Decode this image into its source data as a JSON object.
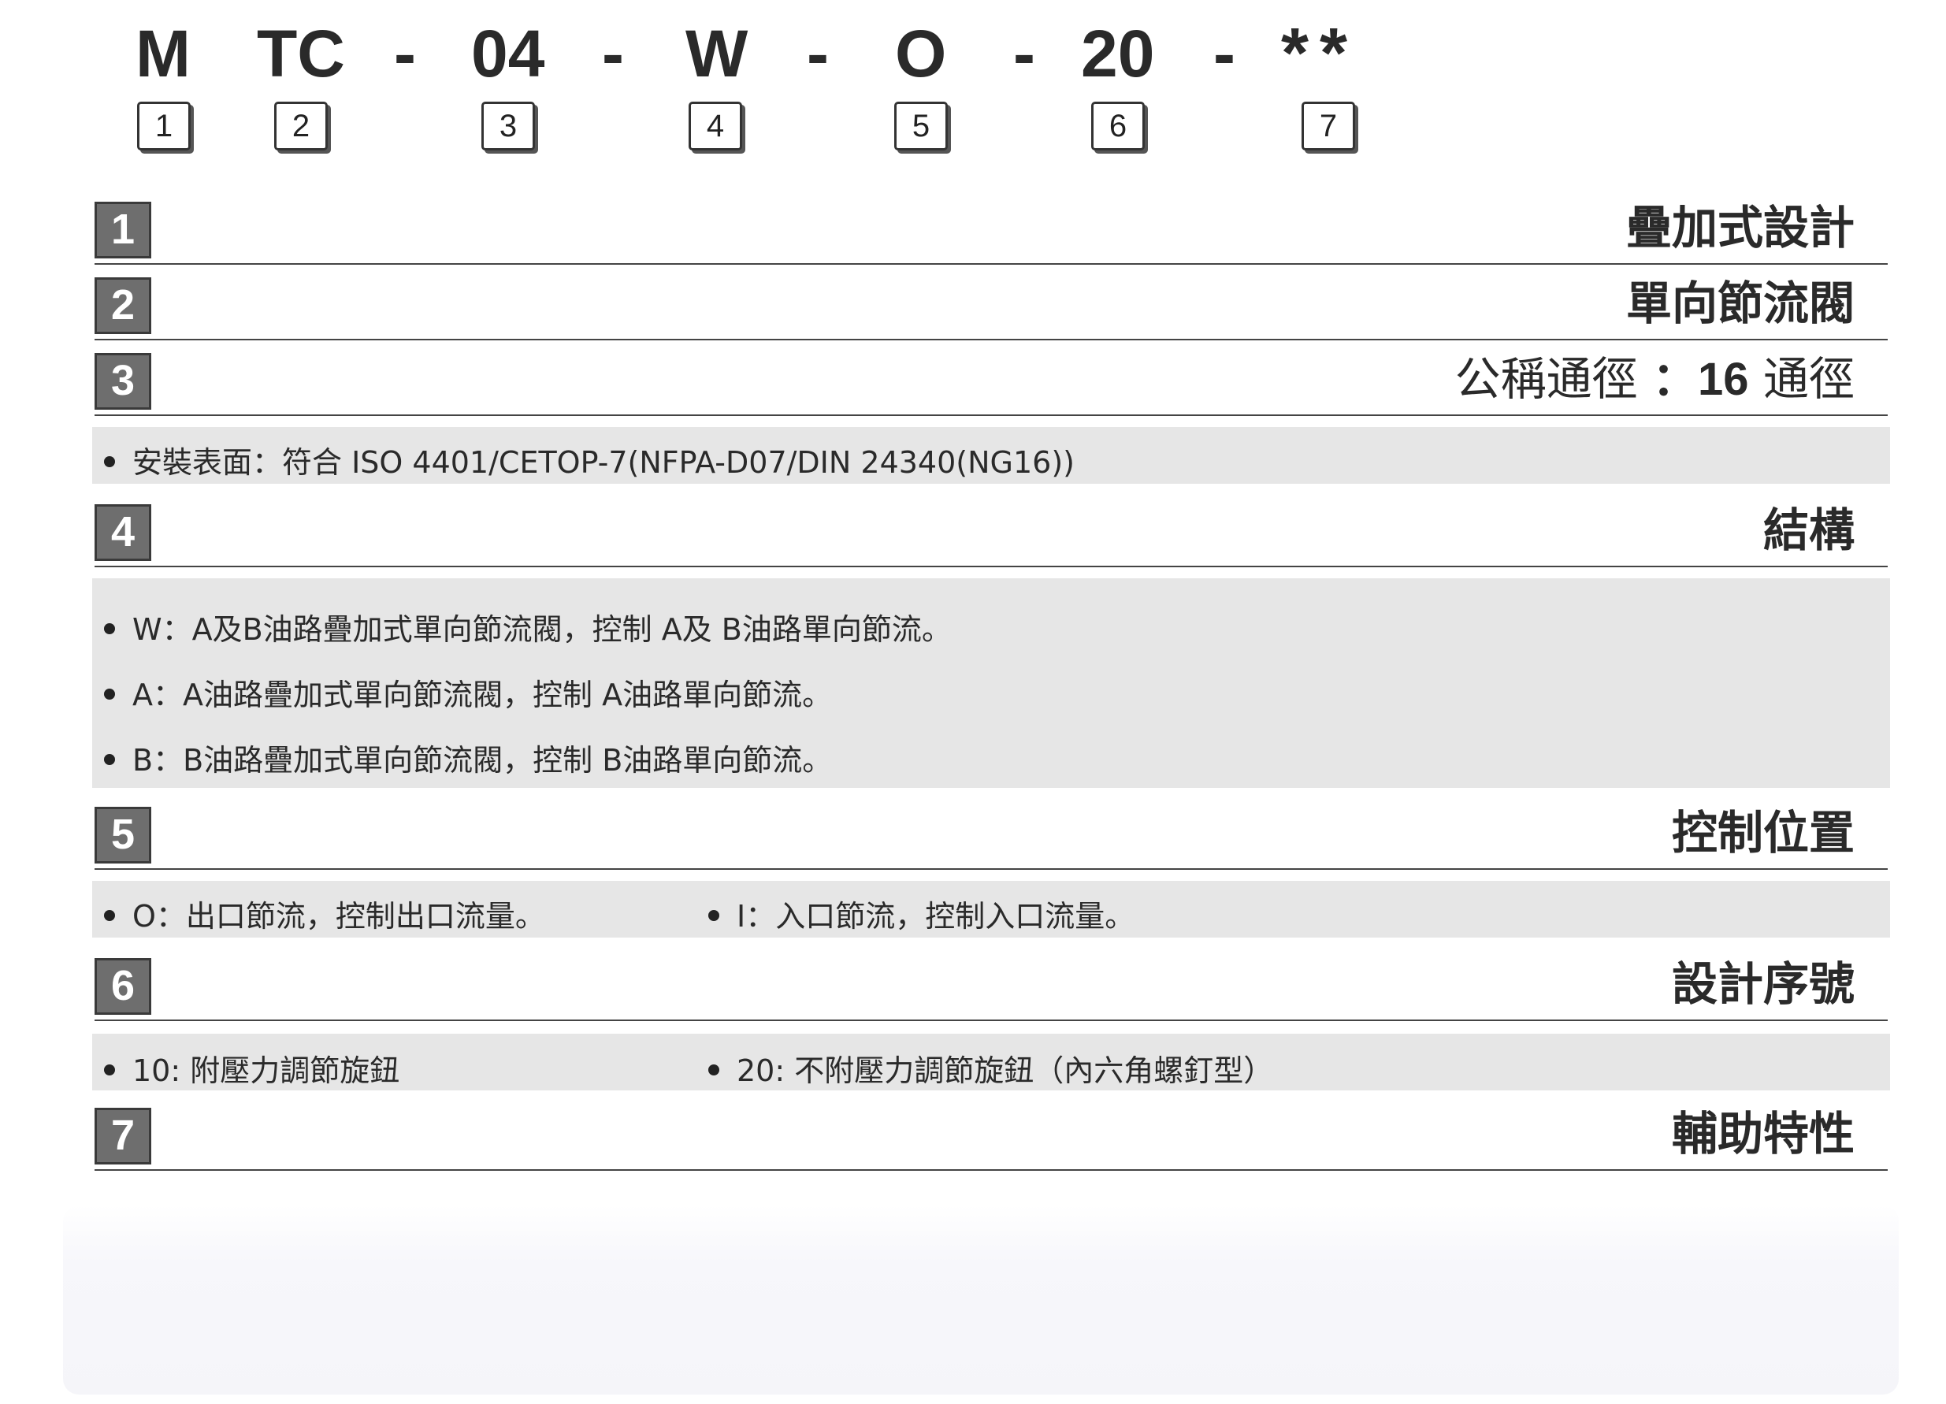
{
  "model_code": {
    "tokens": [
      "M",
      "TC",
      "-",
      "04",
      "-",
      "W",
      "-",
      "O",
      "-",
      "20",
      "-",
      "**"
    ],
    "position_labels": [
      "1",
      "2",
      "3",
      "4",
      "5",
      "6",
      "7"
    ]
  },
  "sections": [
    {
      "num": "1",
      "title": "疊加式設計"
    },
    {
      "num": "2",
      "title": "單向節流閥"
    },
    {
      "num": "3",
      "title_prefix": "公稱通徑",
      "title_colon": "：",
      "title_value": "16",
      "title_suffix": "通徑"
    },
    {
      "num": "4",
      "title": "結構"
    },
    {
      "num": "5",
      "title": "控制位置"
    },
    {
      "num": "6",
      "title": "設計序號"
    },
    {
      "num": "7",
      "title": "輔助特性"
    }
  ],
  "notes": {
    "mounting": "安裝表面：符合 ISO 4401/CETOP-7(NFPA-D07/DIN 24340(NG16))",
    "structure": [
      "W：A及B油路疊加式單向節流閥，控制 A及 B油路單向節流。",
      "A：A油路疊加式單向節流閥，控制 A油路單向節流。",
      "B：B油路疊加式單向節流閥，控制 B油路單向節流。"
    ],
    "control": [
      "O：出口節流，控制出口流量。",
      "I：入口節流，控制入口流量。"
    ],
    "design": [
      "10: 附壓力調節旋鈕",
      "20: 不附壓力調節旋鈕（內六角螺釘型）"
    ]
  }
}
